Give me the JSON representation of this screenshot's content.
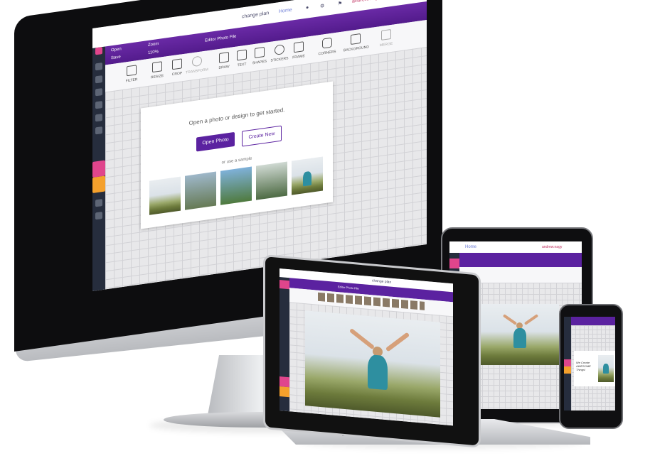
{
  "app": {
    "name": "Editor Photo File",
    "user": "andrew.nagy",
    "plan_link": "change plan",
    "home_link": "Home",
    "flag": "US"
  },
  "toolbar_top": {
    "open": "Open",
    "save": "Save",
    "zoom_label": "Zoom",
    "zoom_value": "110%",
    "file_name": "Editor Photo File"
  },
  "tools": [
    "FILTER",
    "RESIZE",
    "CROP",
    "TRANSFORM",
    "DRAW",
    "TEXT",
    "SHAPES",
    "STICKERS",
    "FRAME",
    "CORNERS",
    "BACKGROUND",
    "MERGE"
  ],
  "start": {
    "prompt": "Open a photo or design to get started.",
    "open_photo": "Open Photo",
    "create_new": "Create New",
    "sample_label": "or use a sample"
  },
  "phone_text": "We Create AWESOME Things!",
  "colors": {
    "brand_purple": "#5b22a0",
    "nav_dark": "#262d3d",
    "accent_pink": "#e0458c",
    "accent_orange": "#f4a02c"
  },
  "icons": [
    "facebook-icon",
    "twitter-icon",
    "instagram-icon",
    "linkedin-icon",
    "pinterest-icon",
    "calendar-icon",
    "chart-icon",
    "settings-icon"
  ]
}
